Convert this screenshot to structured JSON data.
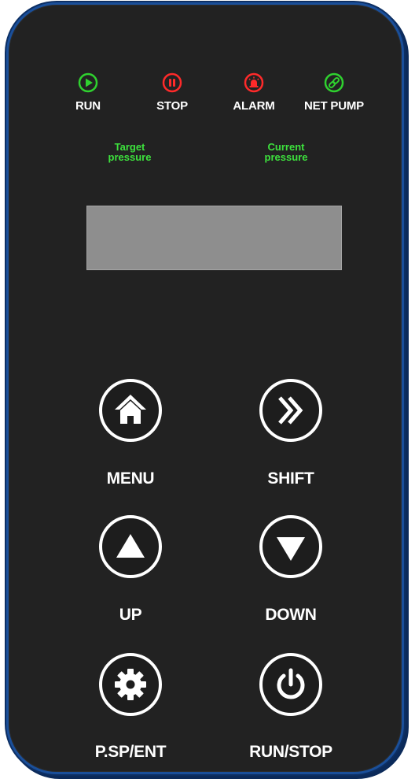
{
  "indicators": [
    {
      "label": "RUN",
      "icon": "play-icon",
      "color": "#2fd12f"
    },
    {
      "label": "STOP",
      "icon": "pause-icon",
      "color": "#ff2a2a"
    },
    {
      "label": "ALARM",
      "icon": "siren-icon",
      "color": "#ff2a2a"
    },
    {
      "label": "NET PUMP",
      "icon": "link-icon",
      "color": "#2fd12f"
    }
  ],
  "pressure": {
    "target_line1": "Target",
    "target_line2": "pressure",
    "current_line1": "Current",
    "current_line2": "pressure"
  },
  "keys": {
    "menu": "MENU",
    "shift": "SHIFT",
    "up": "UP",
    "down": "DOWN",
    "psp_ent": "P.SP/ENT",
    "run_stop": "RUN/STOP"
  },
  "colors": {
    "panel": "#222222",
    "border": "#1a4f9a",
    "lcd": "#8e8e8e",
    "green_text": "#3de13d"
  }
}
